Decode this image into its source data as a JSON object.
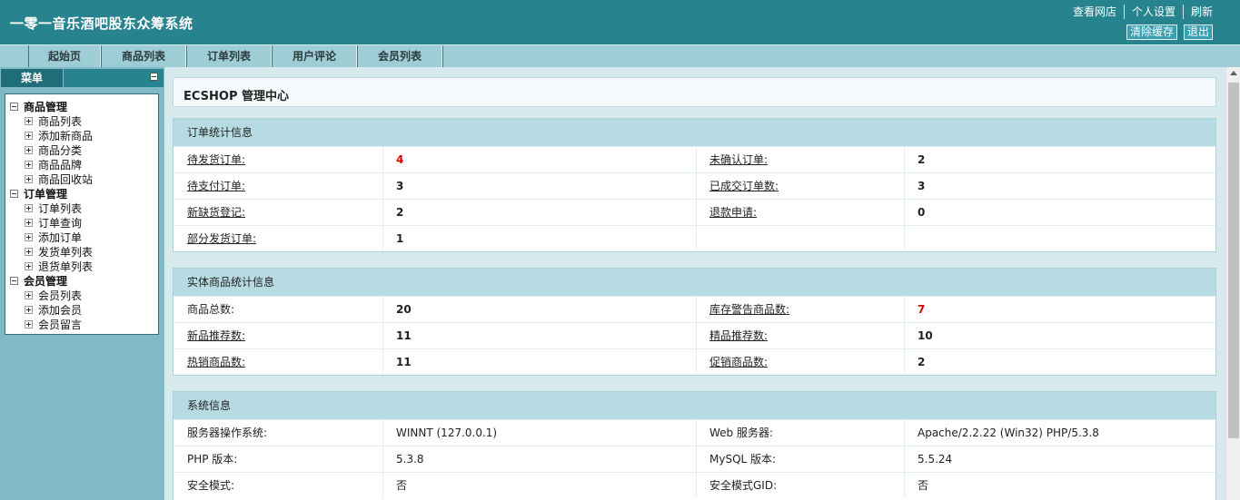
{
  "header": {
    "title": "一零一音乐酒吧股东众筹系统",
    "links": [
      "查看网店",
      "个人设置",
      "刷新"
    ],
    "buttons": [
      "清除缓存",
      "退出"
    ]
  },
  "nav": {
    "tabs": [
      "起始页",
      "商品列表",
      "订单列表",
      "用户评论",
      "会员列表"
    ]
  },
  "sidebar": {
    "menu_label": "菜单",
    "groups": [
      {
        "label": "商品管理",
        "items": [
          "商品列表",
          "添加新商品",
          "商品分类",
          "商品品牌",
          "商品回收站"
        ]
      },
      {
        "label": "订单管理",
        "items": [
          "订单列表",
          "订单查询",
          "添加订单",
          "发货单列表",
          "退货单列表"
        ]
      },
      {
        "label": "会员管理",
        "items": [
          "会员列表",
          "添加会员",
          "会员留言"
        ]
      }
    ]
  },
  "main": {
    "page_title": "ECSHOP 管理中心",
    "order_stats": {
      "title": "订单统计信息",
      "rows": [
        [
          "待发货订单:",
          "4",
          "未确认订单:",
          "2"
        ],
        [
          "待支付订单:",
          "3",
          "已成交订单数:",
          "3"
        ],
        [
          "新缺货登记:",
          "2",
          "退款申请:",
          "0"
        ],
        [
          "部分发货订单:",
          "1",
          "",
          ""
        ]
      ]
    },
    "goods_stats": {
      "title": "实体商品统计信息",
      "rows": [
        [
          "商品总数:",
          "20",
          "库存警告商品数:",
          "7"
        ],
        [
          "新品推荐数:",
          "11",
          "精品推荐数:",
          "10"
        ],
        [
          "热销商品数:",
          "11",
          "促销商品数:",
          "2"
        ]
      ]
    },
    "system_info": {
      "title": "系统信息",
      "rows": [
        [
          "服务器操作系统:",
          "WINNT (127.0.0.1)",
          "Web 服务器:",
          "Apache/2.2.22 (Win32) PHP/5.3.8"
        ],
        [
          "PHP 版本:",
          "5.3.8",
          "MySQL 版本:",
          "5.5.24"
        ],
        [
          "安全模式:",
          "否",
          "安全模式GID:",
          "否"
        ]
      ]
    }
  },
  "colors": {
    "header_bg": "#27848f",
    "nav_bg": "#9fcdd6",
    "sidebar_bg": "#7fbac6",
    "main_bg": "#d6e9ed",
    "panel_head_bg": "#b7dbe2",
    "alert_red": "#e00000"
  }
}
